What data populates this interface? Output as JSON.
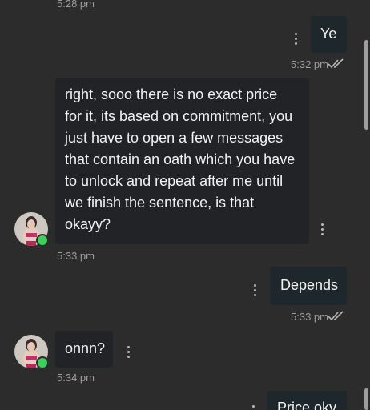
{
  "messages": [
    {
      "id": "m0",
      "direction": "incoming",
      "time": "5:28 pm"
    },
    {
      "id": "m1",
      "direction": "outgoing",
      "text": "Ye",
      "time": "5:32 pm",
      "status": "read"
    },
    {
      "id": "m2",
      "direction": "incoming",
      "lines": [
        "right, sooo there is no exact price",
        "for it, its based on commitment, you",
        "just have to open a few messages",
        "that contain an oath which you have",
        "to unlock and repeat after me until",
        "we finish the sentence, is that",
        "okayy?"
      ],
      "time": "5:33 pm"
    },
    {
      "id": "m3",
      "direction": "outgoing",
      "text": "Depends",
      "time": "5:33 pm",
      "status": "read"
    },
    {
      "id": "m4",
      "direction": "incoming",
      "text": "onnn?",
      "time": "5:34 pm"
    },
    {
      "id": "m5",
      "direction": "outgoing",
      "text": "Price oky"
    }
  ],
  "icons": {
    "more": "vertical-dots-icon",
    "read_receipt": "double-check-icon",
    "online": "online-dot-icon"
  },
  "colors": {
    "background": "#2c2c2c",
    "outgoing_bubble": "#1e272b",
    "incoming_bubble": "#222326",
    "text": "#f2f2f2",
    "timestamp": "#9c9c9c",
    "online": "#3ccf5b"
  }
}
